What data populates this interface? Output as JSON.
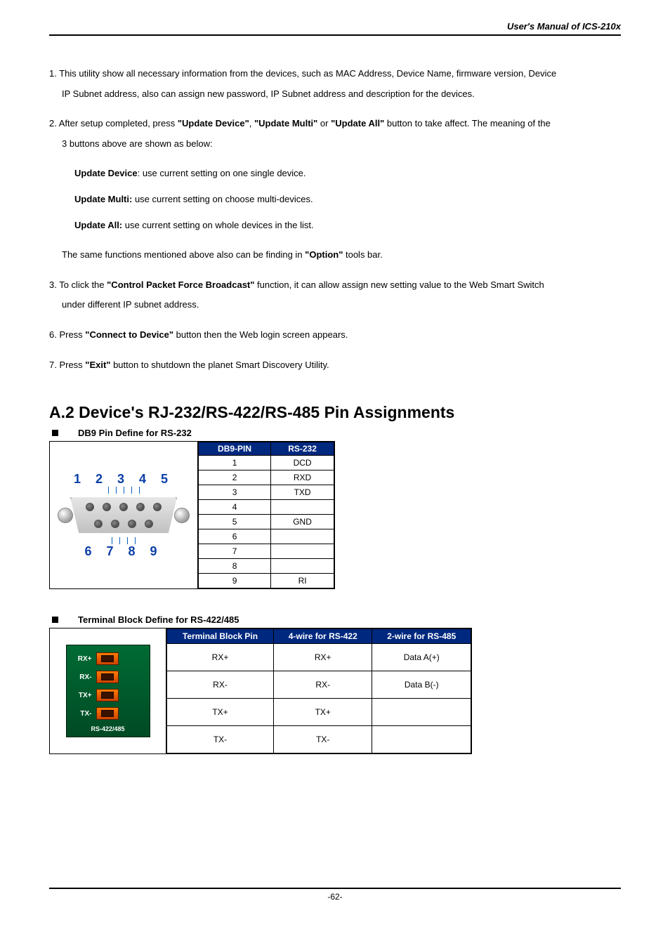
{
  "header": {
    "title": "User's Manual of ICS-210x"
  },
  "items": {
    "p1_prefix": "1. This utility show all necessary information from the devices, such as MAC Address, Device Name, firmware version, Device",
    "p1_line2": "IP Subnet address, also can assign new password, IP Subnet address and description for the devices.",
    "p2_a": "2. After setup completed, press ",
    "p2_b": "\"Update Device\"",
    "p2_c": ", ",
    "p2_d": "\"Update Multi\"",
    "p2_e": " or ",
    "p2_f": "\"Update All\"",
    "p2_g": " button to take affect. The meaning of the",
    "p2_line2": "3 buttons above are shown as below:",
    "ud_label": "Update Device",
    "ud_text": ": use current setting on one single device.",
    "um_label": "Update Multi:",
    "um_text": " use current setting on choose multi-devices.",
    "ua_label": "Update All:",
    "ua_text": " use current setting on whole devices in the list.",
    "same_a": "The same functions mentioned above also can be finding in ",
    "same_b": "\"Option\"",
    "same_c": " tools bar.",
    "p3_a": "3. To click the ",
    "p3_b": "\"Control Packet Force Broadcast\"",
    "p3_c": " function, it can allow assign new setting value to the Web Smart Switch",
    "p3_d": "under different IP subnet address.",
    "p6_a": "6. Press ",
    "p6_b": "\"Connect to Device\"",
    "p6_c": " button then the Web login screen appears.",
    "p7_a": "7. Press ",
    "p7_b": "\"Exit\"",
    "p7_c": " button to shutdown the planet Smart Discovery Utility."
  },
  "section": {
    "a2_title": "A.2 Device's RJ-232/RS-422/RS-485 Pin Assignments",
    "db9_bullet": "DB9 Pin Define for RS-232",
    "tb_bullet": "Terminal Block Define for RS-422/485"
  },
  "db9_draw": {
    "top_nums": "1 2 3 4 5",
    "bot_nums": "6 7 8 9"
  },
  "db9_table": {
    "h1": "DB9-PIN",
    "h2": "RS-232",
    "rows": [
      {
        "pin": "1",
        "sig": "DCD"
      },
      {
        "pin": "2",
        "sig": "RXD"
      },
      {
        "pin": "3",
        "sig": "TXD"
      },
      {
        "pin": "4",
        "sig": ""
      },
      {
        "pin": "5",
        "sig": "GND"
      },
      {
        "pin": "6",
        "sig": ""
      },
      {
        "pin": "7",
        "sig": ""
      },
      {
        "pin": "8",
        "sig": ""
      },
      {
        "pin": "9",
        "sig": "RI"
      }
    ]
  },
  "tb_draw": {
    "rows": [
      "RX+",
      "RX-",
      "TX+",
      "TX-"
    ],
    "caption": "RS-422/485"
  },
  "tb_table": {
    "h1": "Terminal Block Pin",
    "h2": "4-wire for RS-422",
    "h3": "2-wire  for RS-485",
    "rows": [
      {
        "c1": "RX+",
        "c2": "RX+",
        "c3": "Data A(+)"
      },
      {
        "c1": "RX-",
        "c2": "RX-",
        "c3": "Data B(-)"
      },
      {
        "c1": "TX+",
        "c2": "TX+",
        "c3": ""
      },
      {
        "c1": "TX-",
        "c2": "TX-",
        "c3": ""
      }
    ]
  },
  "footer": {
    "page": "-62-"
  }
}
